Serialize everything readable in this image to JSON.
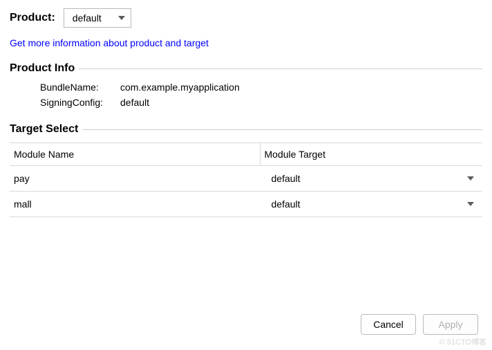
{
  "product": {
    "label": "Product:",
    "value": "default"
  },
  "link_text": "Get more information about product and target",
  "product_info": {
    "section_title": "Product Info",
    "rows": [
      {
        "key": "BundleName:",
        "value": "com.example.myapplication"
      },
      {
        "key": "SigningConfig:",
        "value": "default"
      }
    ]
  },
  "target_select": {
    "section_title": "Target Select",
    "headers": {
      "col1": "Module Name",
      "col2": "Module Target"
    },
    "rows": [
      {
        "name": "pay",
        "target": "default"
      },
      {
        "name": "mall",
        "target": "default"
      }
    ]
  },
  "footer": {
    "cancel": "Cancel",
    "apply": "Apply"
  },
  "watermark": "© 51CTO博客"
}
